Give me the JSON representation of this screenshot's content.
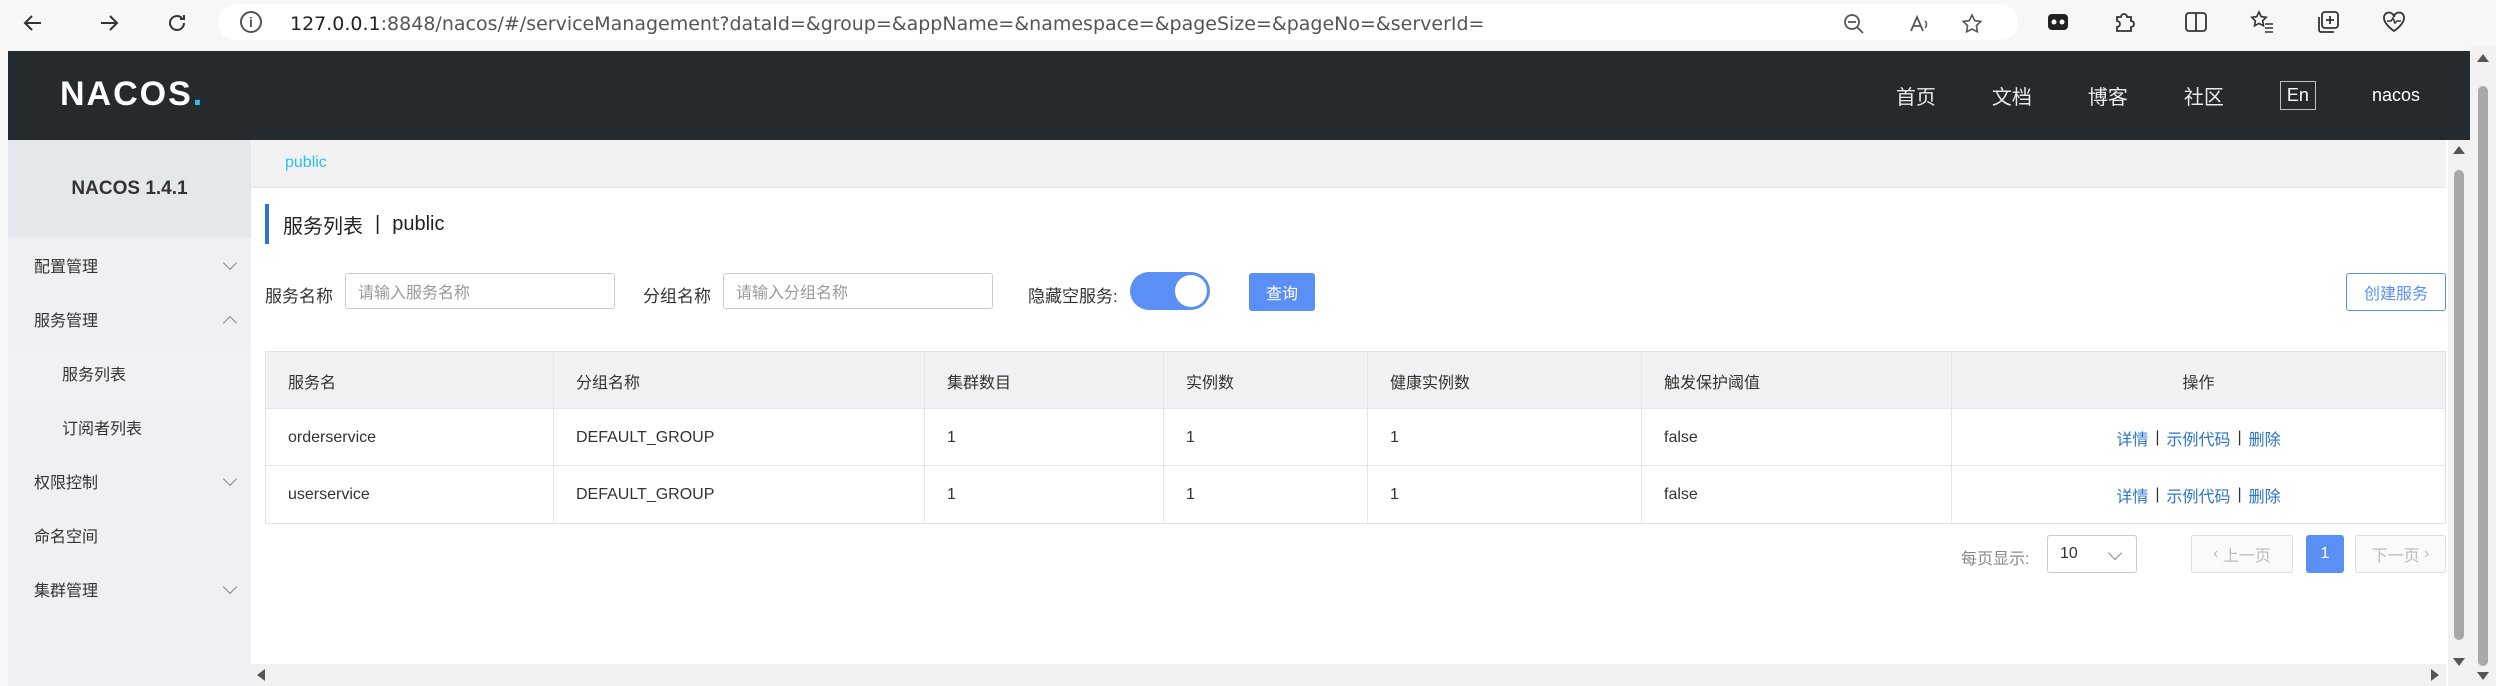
{
  "browser": {
    "url_host": "127.0.0.1",
    "url_rest": ":8848/nacos/#/serviceManagement?dataId=&group=&appName=&namespace=&pageSize=&pageNo=&serverId=",
    "icons": [
      "back-icon",
      "forward-icon",
      "refresh-icon",
      "info-icon",
      "zoom-out-icon",
      "read-aloud-icon",
      "favorite-star-icon",
      "extension-icon",
      "puzzle-icon",
      "split-screen-icon",
      "favorites-icon",
      "collections-icon",
      "heart-pulse-icon"
    ]
  },
  "topnav": {
    "logo": "NACOS",
    "links": [
      "首页",
      "文档",
      "博客",
      "社区"
    ],
    "lang": "En",
    "user": "nacos"
  },
  "sidebar": {
    "title": "NACOS 1.4.1",
    "items": [
      {
        "label": "配置管理"
      },
      {
        "label": "服务管理"
      },
      {
        "label": "服务列表"
      },
      {
        "label": "订阅者列表"
      },
      {
        "label": "权限控制"
      },
      {
        "label": "命名空间"
      },
      {
        "label": "集群管理"
      }
    ]
  },
  "main": {
    "namespace": "public",
    "title": "服务列表",
    "title_sep": "|",
    "title_ns": "public",
    "filters": {
      "service_label": "服务名称",
      "service_placeholder": "请输入服务名称",
      "group_label": "分组名称",
      "group_placeholder": "请输入分组名称",
      "hide_empty_label": "隐藏空服务:",
      "hide_empty_on": true,
      "query_button": "查询",
      "create_button": "创建服务"
    },
    "table": {
      "headers": [
        "服务名",
        "分组名称",
        "集群数目",
        "实例数",
        "健康实例数",
        "触发保护阈值",
        "操作"
      ],
      "rows": [
        {
          "cells": [
            "orderservice",
            "DEFAULT_GROUP",
            "1",
            "1",
            "1",
            "false"
          ]
        },
        {
          "cells": [
            "userservice",
            "DEFAULT_GROUP",
            "1",
            "1",
            "1",
            "false"
          ]
        }
      ],
      "actions": {
        "detail": "详情",
        "sample": "示例代码",
        "delete": "删除"
      }
    },
    "pager": {
      "per_page_label": "每页显示:",
      "page_size": "10",
      "prev": "上一页",
      "current": "1",
      "next": "下一页"
    }
  },
  "colors": {
    "nav_bg": "#252a2f",
    "accent": "#5a8ff5",
    "link": "#2a74c9",
    "ns_link": "#2ac0e8"
  }
}
